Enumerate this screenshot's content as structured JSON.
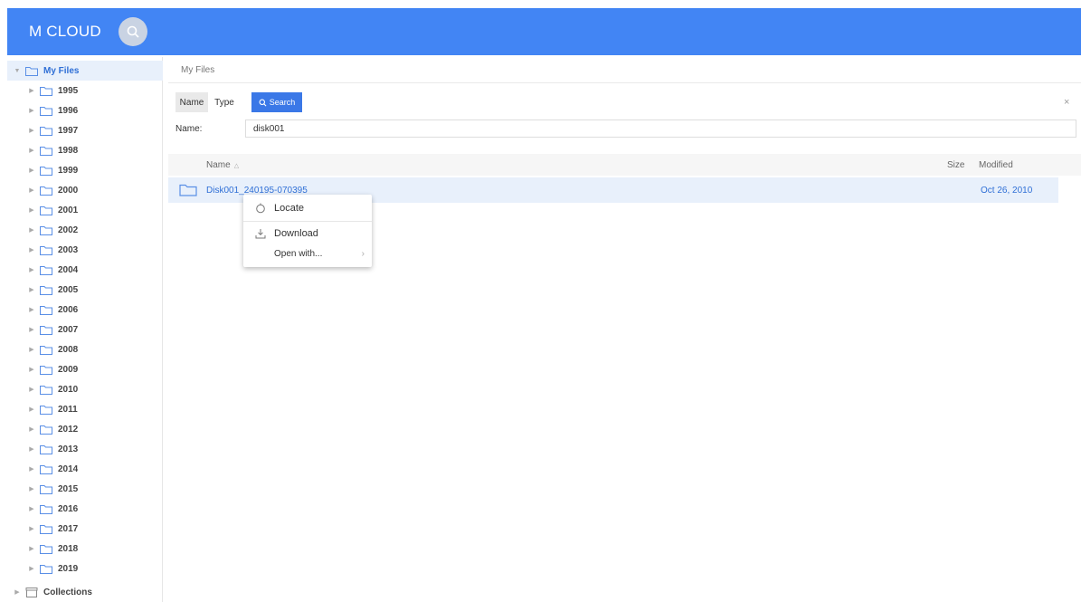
{
  "header": {
    "logo": "M CLOUD",
    "brand_color": "#4285f4"
  },
  "sidebar": {
    "root": {
      "label": "My Files",
      "expanded": true
    },
    "years": [
      "1995",
      "1996",
      "1997",
      "1998",
      "1999",
      "2000",
      "2001",
      "2002",
      "2003",
      "2004",
      "2005",
      "2006",
      "2007",
      "2008",
      "2009",
      "2010",
      "2011",
      "2012",
      "2013",
      "2014",
      "2015",
      "2016",
      "2017",
      "2018",
      "2019"
    ],
    "collections": "Collections"
  },
  "main": {
    "breadcrumb": "My Files",
    "search_tabs": {
      "name": "Name",
      "type": "Type"
    },
    "search_button": "Search",
    "close_symbol": "×",
    "name_field_label": "Name:",
    "name_field_value": "disk001",
    "columns": {
      "name": "Name",
      "size": "Size",
      "modified": "Modified"
    },
    "rows": [
      {
        "name": "Disk001_240195-070395",
        "size": "",
        "modified": "Oct 26, 2010"
      }
    ]
  },
  "context_menu": {
    "items": [
      {
        "label": "Locate",
        "icon": "locate-icon"
      },
      {
        "label": "Download",
        "icon": "download-icon"
      },
      {
        "label": "Open with...",
        "icon": "chevron-right-icon"
      }
    ]
  }
}
